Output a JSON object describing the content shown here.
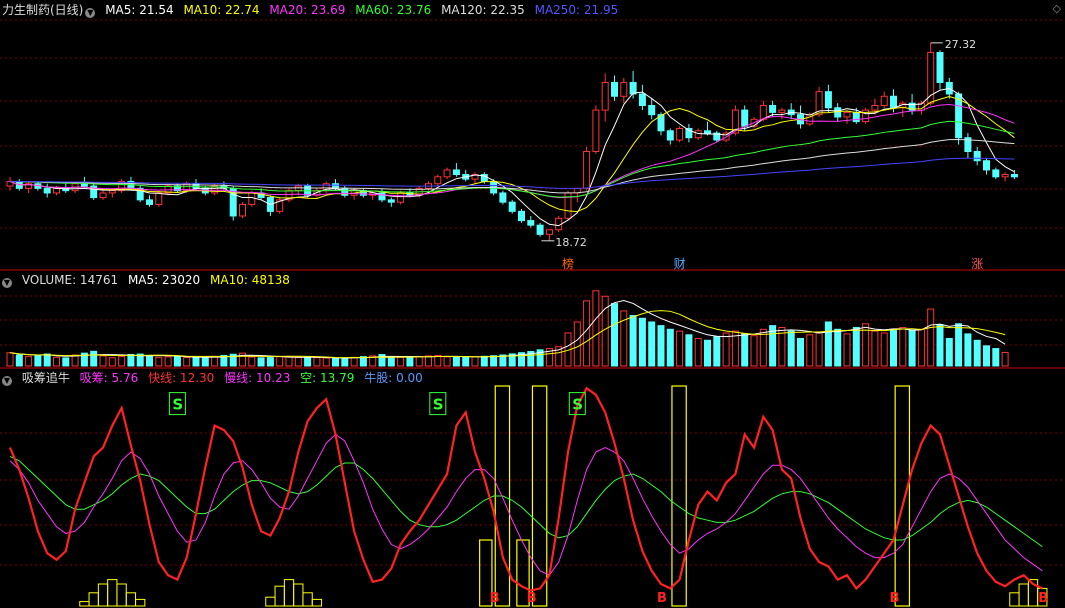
{
  "colors": {
    "up": "#ff3333",
    "down": "#54ffff",
    "ma5": "#ffffff",
    "ma10": "#ffff00",
    "ma20": "#ff33ff",
    "ma60": "#33ff33",
    "ma120": "#dddddd",
    "ma250": "#4444ff",
    "grid": "#7a0000",
    "divider": "#cc0000"
  },
  "price_header": {
    "title": "力生制药(日线)",
    "ma5": "MA5: 21.54",
    "ma10": "MA10: 22.74",
    "ma20": "MA20: 23.69",
    "ma60": "MA60: 23.76",
    "ma120": "MA120: 22.35",
    "ma250": "MA250: 21.95",
    "icon": "chevron-down-icon",
    "corner_icon": "diamond-icon"
  },
  "volume_header": {
    "title": "VOLUME: 14761",
    "ma5": "MA5: 23020",
    "ma10": "MA10: 48138"
  },
  "indicator_header": {
    "title": "吸筹追牛",
    "xichou": "吸筹: 5.76",
    "kuaixian": "快线: 12.30",
    "manxian": "慢线: 10.23",
    "kong": "空: 13.79",
    "niugu": "牛股: 0.00"
  },
  "chart_data": [
    {
      "type": "candlestick",
      "panel": "price",
      "ylim": [
        17.8,
        28.4
      ],
      "annotations": {
        "high": "27.32",
        "low": "18.72",
        "markers": [
          "榜",
          "财",
          "涨"
        ]
      },
      "candles": [
        [
          21.1,
          21.5,
          20.9,
          21.3
        ],
        [
          21.3,
          21.4,
          20.9,
          21.0
        ],
        [
          21.0,
          21.3,
          20.8,
          21.2
        ],
        [
          21.2,
          21.3,
          20.9,
          21.0
        ],
        [
          21.0,
          21.2,
          20.6,
          20.8
        ],
        [
          20.8,
          21.1,
          20.7,
          21.0
        ],
        [
          21.0,
          21.2,
          20.8,
          20.9
        ],
        [
          20.9,
          21.3,
          20.8,
          21.2
        ],
        [
          21.2,
          21.5,
          21.0,
          21.1
        ],
        [
          21.1,
          21.2,
          20.5,
          20.6
        ],
        [
          20.6,
          20.9,
          20.5,
          20.8
        ],
        [
          20.8,
          21.0,
          20.6,
          20.9
        ],
        [
          20.9,
          21.4,
          20.8,
          21.3
        ],
        [
          21.3,
          21.5,
          20.9,
          21.0
        ],
        [
          21.0,
          21.1,
          20.4,
          20.5
        ],
        [
          20.5,
          20.7,
          20.2,
          20.3
        ],
        [
          20.3,
          20.9,
          20.2,
          20.8
        ],
        [
          20.8,
          21.2,
          20.7,
          21.1
        ],
        [
          21.1,
          21.2,
          20.8,
          20.9
        ],
        [
          20.9,
          21.3,
          20.8,
          21.2
        ],
        [
          21.2,
          21.4,
          20.9,
          21.0
        ],
        [
          21.0,
          21.1,
          20.7,
          20.8
        ],
        [
          20.8,
          21.2,
          20.7,
          21.1
        ],
        [
          21.1,
          21.3,
          20.9,
          21.0
        ],
        [
          21.0,
          21.1,
          19.6,
          19.8
        ],
        [
          19.8,
          20.4,
          19.7,
          20.3
        ],
        [
          20.3,
          20.9,
          20.2,
          20.8
        ],
        [
          20.8,
          21.0,
          20.5,
          20.6
        ],
        [
          20.6,
          20.7,
          19.8,
          20.0
        ],
        [
          20.0,
          20.6,
          19.9,
          20.5
        ],
        [
          20.5,
          21.0,
          20.4,
          20.9
        ],
        [
          20.9,
          21.2,
          20.7,
          21.1
        ],
        [
          21.1,
          21.2,
          20.6,
          20.7
        ],
        [
          20.7,
          21.0,
          20.6,
          20.9
        ],
        [
          20.9,
          21.3,
          20.8,
          21.2
        ],
        [
          21.2,
          21.4,
          20.9,
          21.0
        ],
        [
          21.0,
          21.1,
          20.6,
          20.7
        ],
        [
          20.7,
          21.0,
          20.5,
          20.9
        ],
        [
          20.9,
          21.0,
          20.6,
          20.7
        ],
        [
          20.7,
          20.9,
          20.5,
          20.8
        ],
        [
          20.8,
          21.0,
          20.4,
          20.5
        ],
        [
          20.5,
          20.6,
          20.2,
          20.4
        ],
        [
          20.4,
          20.9,
          20.3,
          20.8
        ],
        [
          20.8,
          21.0,
          20.6,
          20.7
        ],
        [
          20.7,
          21.1,
          20.6,
          21.0
        ],
        [
          21.0,
          21.3,
          20.9,
          21.2
        ],
        [
          21.2,
          21.6,
          21.1,
          21.5
        ],
        [
          21.5,
          21.9,
          21.4,
          21.8
        ],
        [
          21.8,
          22.1,
          21.5,
          21.6
        ],
        [
          21.6,
          21.8,
          21.3,
          21.4
        ],
        [
          21.4,
          21.7,
          21.2,
          21.6
        ],
        [
          21.6,
          21.7,
          21.2,
          21.3
        ],
        [
          21.3,
          21.4,
          20.7,
          20.8
        ],
        [
          20.8,
          20.9,
          20.3,
          20.4
        ],
        [
          20.4,
          20.5,
          19.9,
          20.0
        ],
        [
          20.0,
          20.1,
          19.5,
          19.6
        ],
        [
          19.6,
          19.8,
          19.3,
          19.4
        ],
        [
          19.4,
          19.5,
          18.9,
          19.0
        ],
        [
          19.0,
          19.2,
          18.72,
          19.2
        ],
        [
          19.2,
          19.8,
          19.1,
          19.7
        ],
        [
          19.7,
          20.9,
          19.6,
          20.8
        ],
        [
          20.8,
          21.0,
          20.4,
          21.0
        ],
        [
          21.0,
          22.8,
          20.9,
          22.6
        ],
        [
          22.6,
          24.6,
          22.5,
          24.4
        ],
        [
          24.4,
          26.0,
          23.9,
          25.6
        ],
        [
          25.6,
          25.9,
          24.8,
          25.0
        ],
        [
          25.0,
          25.8,
          24.7,
          25.6
        ],
        [
          25.6,
          26.1,
          24.9,
          25.1
        ],
        [
          25.1,
          25.5,
          24.4,
          24.6
        ],
        [
          24.6,
          24.9,
          24.0,
          24.2
        ],
        [
          24.2,
          24.3,
          23.3,
          23.5
        ],
        [
          23.5,
          23.6,
          22.9,
          23.1
        ],
        [
          23.1,
          23.7,
          23.0,
          23.6
        ],
        [
          23.6,
          23.8,
          23.0,
          23.2
        ],
        [
          23.2,
          23.6,
          23.1,
          23.5
        ],
        [
          23.5,
          23.9,
          23.3,
          23.4
        ],
        [
          23.4,
          23.5,
          23.0,
          23.1
        ],
        [
          23.1,
          23.5,
          23.0,
          23.4
        ],
        [
          23.4,
          24.6,
          23.3,
          24.4
        ],
        [
          24.4,
          24.6,
          23.5,
          23.7
        ],
        [
          23.7,
          24.1,
          23.6,
          24.0
        ],
        [
          24.0,
          24.8,
          23.9,
          24.6
        ],
        [
          24.6,
          24.8,
          24.1,
          24.3
        ],
        [
          24.3,
          24.5,
          24.0,
          24.4
        ],
        [
          24.4,
          24.7,
          24.0,
          24.2
        ],
        [
          24.2,
          24.6,
          23.6,
          23.8
        ],
        [
          23.8,
          24.3,
          23.7,
          24.2
        ],
        [
          24.2,
          25.4,
          24.1,
          25.2
        ],
        [
          25.2,
          25.5,
          24.3,
          24.5
        ],
        [
          24.5,
          24.7,
          23.9,
          24.1
        ],
        [
          24.1,
          24.4,
          23.8,
          24.3
        ],
        [
          24.3,
          24.5,
          23.8,
          23.9
        ],
        [
          23.9,
          24.5,
          23.8,
          24.4
        ],
        [
          24.4,
          24.9,
          24.2,
          24.6
        ],
        [
          24.6,
          25.2,
          24.5,
          25.0
        ],
        [
          25.0,
          25.3,
          24.3,
          24.5
        ],
        [
          24.5,
          24.8,
          24.1,
          24.7
        ],
        [
          24.7,
          25.1,
          24.2,
          24.4
        ],
        [
          24.4,
          24.8,
          24.2,
          24.7
        ],
        [
          24.7,
          27.32,
          24.6,
          26.9
        ],
        [
          26.9,
          27.0,
          25.3,
          25.6
        ],
        [
          25.6,
          25.8,
          24.9,
          25.1
        ],
        [
          25.1,
          25.2,
          22.9,
          23.2
        ],
        [
          23.2,
          23.4,
          22.3,
          22.6
        ],
        [
          22.6,
          22.8,
          22.0,
          22.2
        ],
        [
          22.2,
          22.3,
          21.6,
          21.8
        ],
        [
          21.8,
          21.9,
          21.4,
          21.5
        ],
        [
          21.5,
          21.7,
          21.3,
          21.6
        ],
        [
          21.6,
          21.8,
          21.4,
          21.5
        ]
      ]
    },
    {
      "type": "bar",
      "panel": "volume",
      "ylim": [
        0,
        85000
      ],
      "values": [
        14500,
        12000,
        10500,
        11000,
        13000,
        9500,
        8800,
        12000,
        14000,
        16000,
        11000,
        9000,
        10500,
        12500,
        13000,
        11000,
        9500,
        10000,
        10800,
        9200,
        8800,
        9000,
        10500,
        11500,
        12800,
        14000,
        9800,
        8900,
        9200,
        10100,
        10500,
        9300,
        8700,
        9100,
        8600,
        8400,
        8800,
        9500,
        10200,
        11000,
        12500,
        9000,
        9400,
        9800,
        10200,
        11000,
        11500,
        10000,
        9700,
        9500,
        10000,
        10600,
        11200,
        12000,
        13200,
        14500,
        15800,
        17600,
        19000,
        21000,
        36000,
        48000,
        71000,
        82000,
        76000,
        68000,
        60000,
        55000,
        52000,
        48000,
        44000,
        40000,
        38000,
        34000,
        30000,
        28000,
        32000,
        36000,
        38000,
        35000,
        33000,
        40000,
        44000,
        42000,
        38000,
        30000,
        34000,
        36000,
        48000,
        40000,
        35000,
        42000,
        46000,
        38000,
        36000,
        40000,
        42000,
        39000,
        40000,
        62000,
        45000,
        30000,
        46000,
        35000,
        28000,
        22000,
        19000,
        14761
      ],
      "ma5_label": "MA5: 23020",
      "ma10_label": "MA10: 48138"
    },
    {
      "type": "line",
      "panel": "indicator",
      "ylim": [
        0,
        100
      ],
      "labels": [
        "S",
        "S",
        "S",
        "B",
        "B",
        "B",
        "B",
        "B"
      ],
      "series": [
        {
          "name": "快线",
          "values": [
            72,
            62,
            49,
            34,
            24,
            21,
            25,
            44,
            56,
            68,
            72,
            82,
            90,
            73,
            57,
            37,
            20,
            14,
            12,
            22,
            42,
            63,
            82,
            80,
            75,
            63,
            46,
            34,
            32,
            40,
            52,
            70,
            84,
            90,
            94,
            78,
            56,
            34,
            21,
            11,
            12,
            17,
            28,
            34,
            39,
            46,
            53,
            60,
            82,
            88,
            70,
            58,
            43,
            22,
            12,
            9,
            7,
            8,
            14,
            40,
            70,
            91,
            99,
            96,
            88,
            74,
            58,
            39,
            25,
            16,
            10,
            8,
            12,
            30,
            46,
            52,
            48,
            56,
            60,
            78,
            72,
            86,
            80,
            62,
            58,
            40,
            26,
            20,
            18,
            12,
            14,
            8,
            12,
            18,
            24,
            30,
            46,
            62,
            74,
            82,
            78,
            64,
            50,
            36,
            24,
            16,
            11,
            9,
            12,
            14,
            10,
            8
          ]
        },
        {
          "name": "慢线",
          "values": [
            66,
            62,
            56,
            48,
            42,
            36,
            33,
            34,
            38,
            45,
            51,
            58,
            66,
            70,
            67,
            60,
            50,
            42,
            34,
            29,
            30,
            38,
            50,
            60,
            65,
            66,
            62,
            56,
            49,
            45,
            44,
            50,
            58,
            66,
            74,
            78,
            75,
            66,
            56,
            44,
            35,
            28,
            26,
            28,
            31,
            35,
            40,
            45,
            52,
            58,
            62,
            62,
            58,
            49,
            39,
            30,
            22,
            16,
            14,
            20,
            32,
            48,
            62,
            70,
            72,
            70,
            66,
            58,
            49,
            41,
            34,
            28,
            24,
            26,
            30,
            33,
            35,
            38,
            42,
            48,
            54,
            60,
            64,
            64,
            62,
            58,
            52,
            46,
            40,
            35,
            31,
            27,
            24,
            22,
            22,
            24,
            28,
            36,
            44,
            52,
            58,
            60,
            58,
            54,
            48,
            42,
            36,
            30,
            26,
            22,
            19,
            16
          ]
        },
        {
          "name": "空",
          "values": [
            68,
            66,
            62,
            58,
            54,
            50,
            46,
            44,
            44,
            46,
            48,
            51,
            55,
            58,
            60,
            59,
            57,
            53,
            49,
            45,
            42,
            42,
            44,
            48,
            52,
            55,
            57,
            57,
            56,
            54,
            52,
            51,
            52,
            55,
            59,
            63,
            65,
            65,
            62,
            58,
            53,
            48,
            43,
            39,
            37,
            36,
            36,
            37,
            39,
            42,
            45,
            48,
            50,
            50,
            48,
            45,
            41,
            37,
            33,
            31,
            32,
            36,
            42,
            48,
            53,
            57,
            59,
            60,
            58,
            55,
            52,
            48,
            45,
            42,
            40,
            39,
            38,
            38,
            39,
            41,
            43,
            46,
            49,
            51,
            52,
            52,
            51,
            49,
            47,
            44,
            41,
            38,
            35,
            33,
            31,
            30,
            30,
            32,
            35,
            38,
            42,
            45,
            47,
            48,
            47,
            45,
            42,
            39,
            36,
            33,
            30,
            27
          ]
        },
        {
          "name": "吸筹",
          "values": [
            0,
            0,
            0,
            0,
            0,
            0,
            0,
            0,
            2,
            6,
            10,
            12,
            10,
            6,
            3,
            0,
            0,
            0,
            0,
            0,
            0,
            0,
            0,
            0,
            0,
            0,
            0,
            0,
            4,
            9,
            12,
            10,
            6,
            3,
            0,
            0,
            0,
            0,
            0,
            0,
            0,
            0,
            0,
            0,
            0,
            0,
            0,
            0,
            0,
            0,
            0,
            0,
            0,
            0,
            0,
            0,
            0,
            0,
            0,
            0,
            0,
            0,
            0,
            0,
            0,
            0,
            0,
            0,
            0,
            0,
            0,
            0,
            0,
            0,
            0,
            0,
            0,
            0,
            0,
            0,
            0,
            0,
            0,
            0,
            0,
            0,
            0,
            0,
            0,
            0,
            0,
            0,
            0,
            0,
            0,
            0,
            0,
            0,
            0,
            0,
            0,
            0,
            0,
            0,
            0,
            0,
            0,
            0,
            6,
            10,
            12,
            8
          ]
        }
      ]
    }
  ]
}
